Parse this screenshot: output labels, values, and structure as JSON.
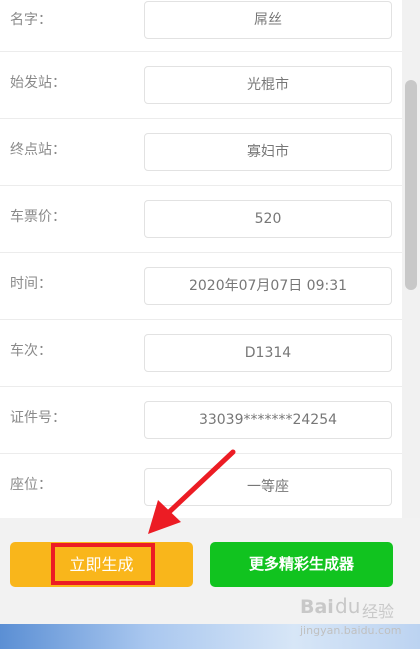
{
  "form": {
    "rows": [
      {
        "label": "名字：",
        "value": "屌丝"
      },
      {
        "label": "始发站：",
        "value": "光棍市"
      },
      {
        "label": "终点站：",
        "value": "寡妇市"
      },
      {
        "label": "车票价：",
        "value": "520"
      },
      {
        "label": "时间：",
        "value": "2020年07月07日  09:31"
      },
      {
        "label": "车次：",
        "value": "D1314"
      },
      {
        "label": "证件号：",
        "value": "33039*******24254"
      },
      {
        "label": "座位：",
        "value": "一等座"
      }
    ]
  },
  "actions": {
    "generate_label": "立即生成",
    "more_label": "更多精彩生成器"
  },
  "watermark": {
    "logo": "Bai",
    "paw": "du",
    "brand": "经验",
    "site": "jingyan.baidu.com"
  },
  "colors": {
    "generate_button": "#f9b61b",
    "more_button": "#11c31f",
    "highlight": "#ec1c24"
  }
}
